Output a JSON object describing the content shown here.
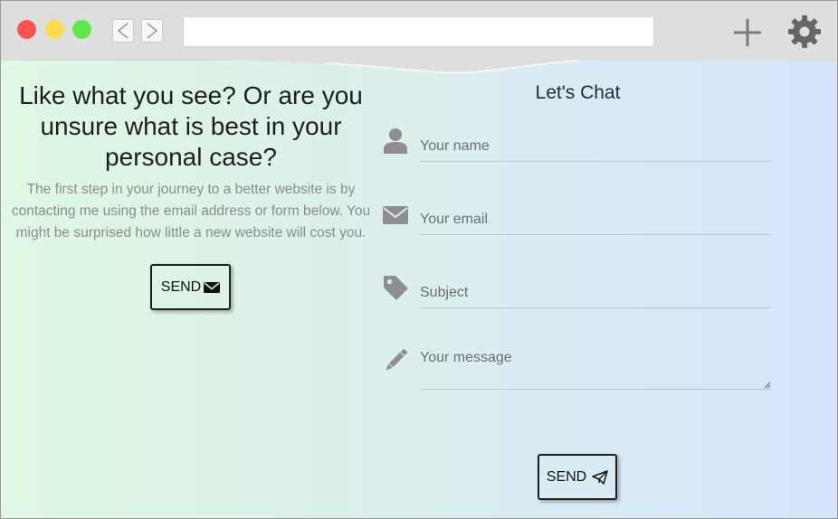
{
  "browser": {
    "url": ""
  },
  "icons": {
    "back": "chevron-left-icon",
    "forward": "chevron-right-icon",
    "new_tab": "plus-icon",
    "settings": "gear-icon",
    "name": "user-icon",
    "email": "envelope-icon",
    "subject": "tag-icon",
    "message": "pencil-icon",
    "send_top": "envelope-icon",
    "send_bottom": "paper-plane-icon"
  },
  "colors": {
    "close": "#fd5451",
    "minimize": "#fedb4d",
    "maximize": "#5ee84b",
    "gradient_left": "#dff8e3",
    "gradient_right": "#d6e3fb"
  },
  "intro": {
    "headline": "Like what you see? Or are you unsure what is best in your personal case?",
    "body": "The first step in your journey to a better website is by contacting me using the email address or form below. You might be surprised how little a new website will cost you.",
    "send_label": "SEND"
  },
  "contact_form": {
    "title": "Let's Chat",
    "name_placeholder": "Your name",
    "email_placeholder": "Your email",
    "subject_placeholder": "Subject",
    "message_placeholder": "Your message",
    "send_label": "SEND"
  }
}
